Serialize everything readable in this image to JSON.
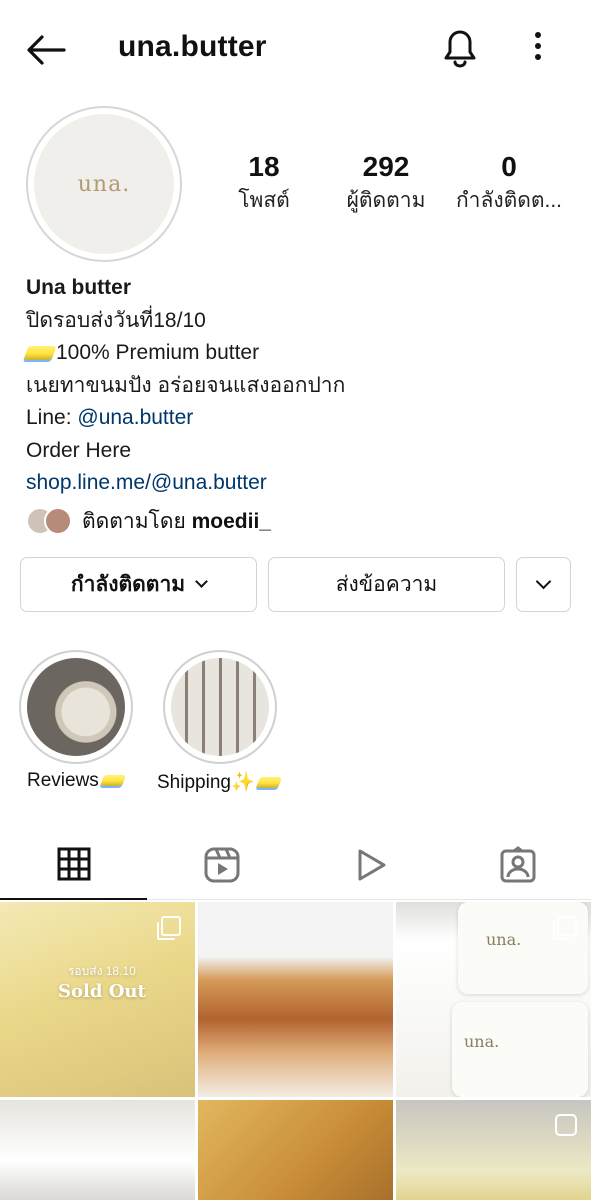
{
  "header": {
    "username": "una.butter"
  },
  "profile": {
    "avatar_text": "una.",
    "stats": [
      {
        "value": "18",
        "label": "โพสต์"
      },
      {
        "value": "292",
        "label": "ผู้ติดตาม"
      },
      {
        "value": "0",
        "label": "กำลังติดต..."
      }
    ],
    "bio": {
      "name": "Una butter",
      "line1": "ปิดรอบส่งวันที่18/10",
      "line2": "100% Premium butter",
      "line3": "เนยทาขนมปัง อร่อยจนแสงออกปาก",
      "line4_prefix": "Line: ",
      "line4_link": "@una.butter",
      "line5": "Order Here",
      "line6_link": "shop.line.me/@una.butter"
    },
    "followed_by": {
      "prefix": "ติดตามโดย ",
      "user": "moedii_"
    }
  },
  "actions": {
    "following_label": "กำลังติดตาม",
    "message_label": "ส่งข้อความ"
  },
  "highlights": [
    {
      "label": "Reviews"
    },
    {
      "label": "Shipping"
    }
  ],
  "posts": {
    "post1_overlay_small": "รอบส่ง 18.10",
    "post1_overlay_big": "Sold Out",
    "post3_brand": "una.",
    "post3_brand2": "una."
  },
  "colors": {
    "link": "#00376b",
    "border": "#d4d4d4"
  }
}
